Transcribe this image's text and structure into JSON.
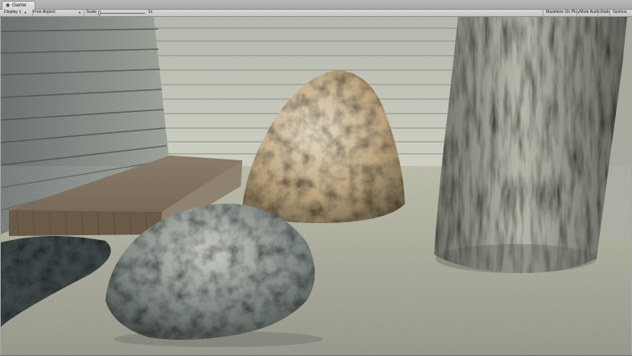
{
  "tab": {
    "icon": "game-view-icon",
    "label": "Game"
  },
  "toolbar": {
    "display": "Display 1",
    "aspect": "Free Aspect",
    "scale_label": "Scale",
    "scale_value": "1x",
    "scale_level": 0.0,
    "maximize_on_play": "Maximize On Play",
    "mute_audio": "Mute Audio",
    "stats": "Stats",
    "gizmos": "Gizmos"
  },
  "colors": {
    "tab_active": "#d9d9d9",
    "toolbar": "#cbcbcb",
    "sand": "#b8b8a8",
    "wall": "#c2c4b8",
    "wood": "#7f6e5a",
    "rock_warm": "#c9b28e",
    "rock_cool": "#6e7571",
    "bark": "#8f9387"
  },
  "scene": {
    "objects": [
      "wooden-wall-left",
      "wooden-wall-back",
      "wooden-plank",
      "sand-floor",
      "beige-rock",
      "grey-rock",
      "tree-trunk",
      "dark-stone-patch",
      "stucco-wall-right"
    ]
  }
}
